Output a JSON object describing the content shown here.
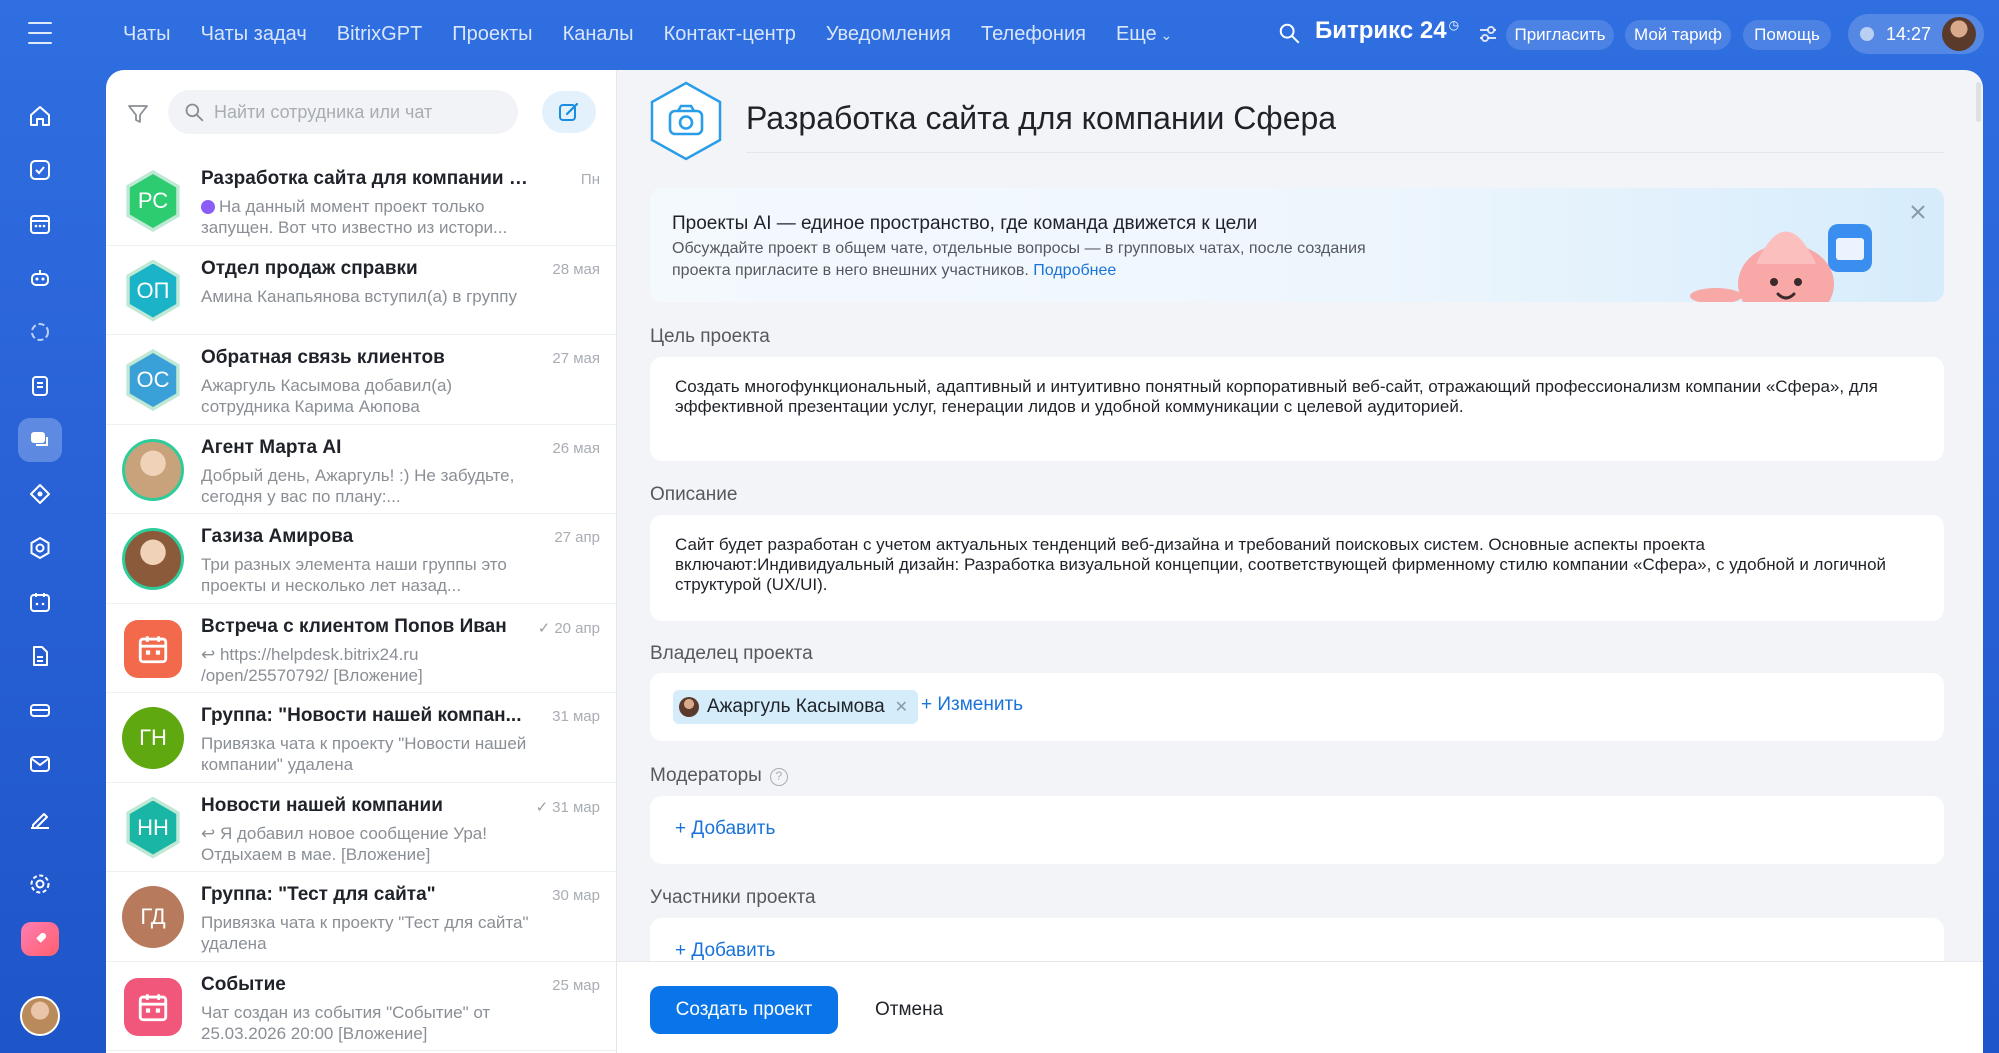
{
  "topnav": {
    "items": [
      "Чаты",
      "Чаты задач",
      "BitrixGPT",
      "Проекты",
      "Каналы",
      "Контакт-центр",
      "Уведомления",
      "Телефония"
    ],
    "more": "Еще",
    "brand": "Битрикс 24",
    "invite": "Пригласить",
    "tariff": "Мой тариф",
    "help": "Помощь",
    "time": "14:27"
  },
  "rail": {
    "icons": [
      "home-icon",
      "task-icon",
      "calendar-grid-icon",
      "robot-icon",
      "crm-icon",
      "document-icon",
      "chat-icon",
      "market-icon",
      "target-icon",
      "calendar-icon",
      "file-icon",
      "drive-icon",
      "mail-icon",
      "sign-icon",
      "gear-icon",
      "rocket-icon"
    ]
  },
  "chats": {
    "search_placeholder": "Найти сотрудника или чат",
    "items": [
      {
        "title": "Разработка сайта для компании Сф...",
        "date": "Пн",
        "preview": "На данный момент проект только запущен. Вот что известно из истори...",
        "avatar": "РС",
        "color": "#2ecc71",
        "shape": "hex"
      },
      {
        "title": "Отдел продаж справки",
        "date": "28 мая",
        "preview": "Амина Канапьянова вступил(а) в группу",
        "avatar": "ОП",
        "color": "#1ab3c8",
        "shape": "hex"
      },
      {
        "title": "Обратная связь клиентов",
        "date": "27 мая",
        "preview": "Ажаргуль Касымова добавил(а) сотрудника Карима Аюпова",
        "avatar": "ОС",
        "color": "#3aa0d8",
        "shape": "hex"
      },
      {
        "title": "Агент Марта AI",
        "date": "26 мая",
        "preview": "Добрый день, Ажаргуль! :) Не забудьте, сегодня у вас по плану:...",
        "avatar": "",
        "color": "#c8a27a",
        "shape": "photo"
      },
      {
        "title": "Газиза Амирова",
        "date": "27 апр",
        "preview": "Три разных элемента наши группы это проекты и несколько лет назад...",
        "avatar": "",
        "color": "#8a5a3a",
        "shape": "photo"
      },
      {
        "title": "Встреча с клиентом Попов Иван",
        "date": "20 апр",
        "check": "✓",
        "preview": "↩ https://helpdesk.bitrix24.ru /open/25570792/ [Вложение]",
        "avatar": "",
        "color": "#f26a4b",
        "shape": "calendar"
      },
      {
        "title": "Группа: \"Новости нашей компан...",
        "date": "31 мар",
        "preview": "Привязка чата к проекту \"Новости нашей компании\" удалена",
        "avatar": "ГН",
        "color": "#5fa80f",
        "shape": "round"
      },
      {
        "title": "Новости нашей компании",
        "date": "31 мар",
        "check": "✓",
        "preview": "↩ Я добавил новое сообщение Ура! Отдыхаем в мае. [Вложение]",
        "avatar": "НН",
        "color": "#19b5a5",
        "shape": "hex"
      },
      {
        "title": "Группа: \"Тест для сайта\"",
        "date": "30 мар",
        "preview": "Привязка чата к проекту \"Тест для сайта\" удалена",
        "avatar": "ГД",
        "color": "#b87a5c",
        "shape": "round"
      },
      {
        "title": "Событие",
        "date": "25 мар",
        "preview": "Чат создан из события \"Событие\" от 25.03.2026 20:00 [Вложение]",
        "avatar": "",
        "color": "#f0577a",
        "shape": "calendar"
      }
    ]
  },
  "form": {
    "title": "Разработка сайта для компании Сфера",
    "banner": {
      "title": "Проекты AI — единое пространство, где команда движется к цели",
      "text": "Обсуждайте проект в общем чате, отдельные вопросы — в групповых чатах, после создания проекта пригласите в него внешних участников.",
      "link": "Подробнее"
    },
    "goal_label": "Цель проекта",
    "goal_value": "Создать многофункциональный, адаптивный и интуитивно понятный корпоративный веб-сайт, отражающий профессионализм компании «Сфера», для эффективной презентации услуг, генерации лидов и удобной коммуникации с целевой аудиторией.",
    "description_label": "Описание",
    "description_value": "Сайт будет разработан с учетом актуальных тенденций веб-дизайна и требований поисковых систем. Основные аспекты проекта включают:Индивидуальный дизайн: Разработка визуальной концепции, соответствующей фирменному стилю компании «Сфера», с удобной и логичной структурой (UX/UI).",
    "owner_label": "Владелец проекта",
    "owner_name": "Ажаргуль Касымова",
    "owner_change": "+ Изменить",
    "moderators_label": "Модераторы",
    "moderators_add": "+ Добавить",
    "members_label": "Участники проекта",
    "members_add": "+ Добавить",
    "create": "Создать проект",
    "cancel": "Отмена"
  }
}
